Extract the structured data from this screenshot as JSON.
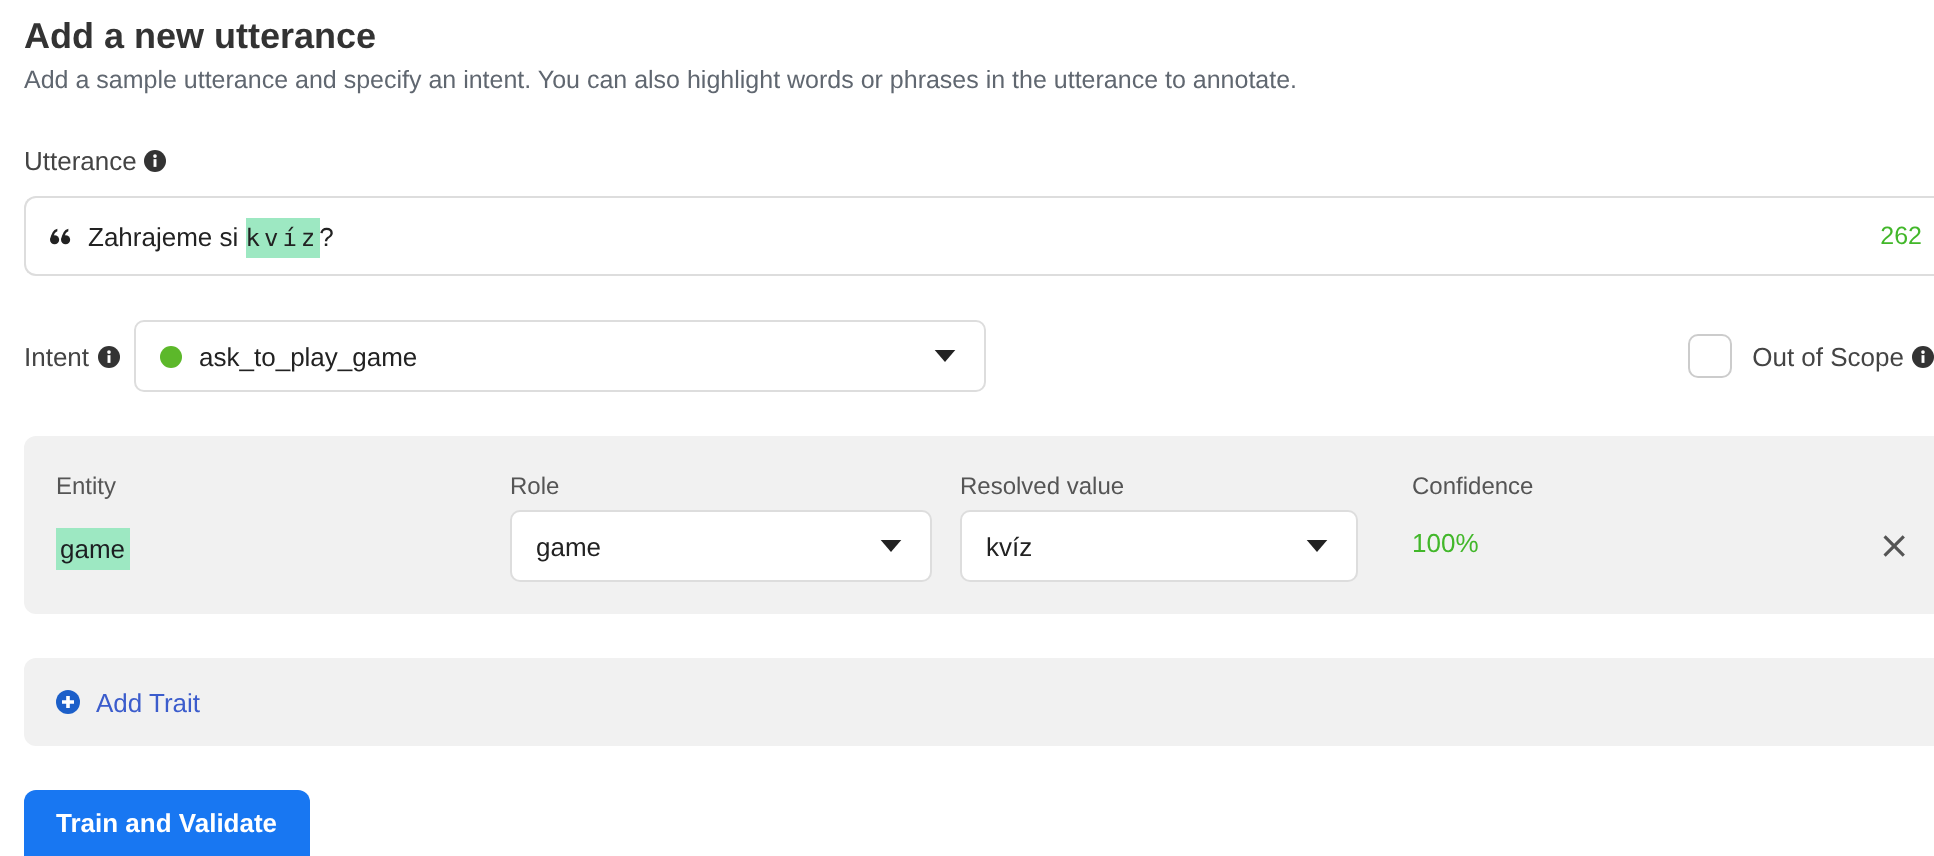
{
  "header": {
    "title": "Add a new utterance",
    "description": "Add a sample utterance and specify an intent. You can also highlight words or phrases in the utterance to annotate."
  },
  "utterance": {
    "label": "Utterance",
    "parts": [
      {
        "text": "Zahrajeme si ",
        "highlighted": false
      },
      {
        "text": "kvíz",
        "highlighted": true
      },
      {
        "text": "?",
        "highlighted": false
      }
    ],
    "count": "262"
  },
  "intent": {
    "label": "Intent",
    "value": "ask_to_play_game",
    "color": "#5cb82a"
  },
  "out_of_scope": {
    "label": "Out of Scope",
    "checked": false
  },
  "entity_panel": {
    "columns": [
      "Entity",
      "Role",
      "Resolved value",
      "Confidence"
    ],
    "entity": "game",
    "role": "game",
    "resolved_value": "kvíz",
    "confidence": "100%",
    "remove": "×"
  },
  "trait": {
    "label": "Add Trait"
  },
  "submit": {
    "label": "Train and Validate"
  }
}
